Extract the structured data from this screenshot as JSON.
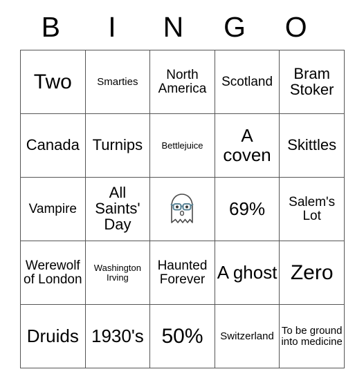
{
  "card": {
    "title": "BINGO",
    "header_letters": [
      "B",
      "I",
      "N",
      "G",
      "O"
    ],
    "rows": [
      [
        {
          "text": "Two",
          "size": "t-xxl"
        },
        {
          "text": "Smarties",
          "size": "t-sm"
        },
        {
          "text": "North America",
          "size": "t-md"
        },
        {
          "text": "Scotland",
          "size": "t-md"
        },
        {
          "text": "Bram Stoker",
          "size": "t-lg"
        }
      ],
      [
        {
          "text": "Canada",
          "size": "t-lg"
        },
        {
          "text": "Turnips",
          "size": "t-lg"
        },
        {
          "text": "Bettlejuice",
          "size": "t-xs"
        },
        {
          "text": "A coven",
          "size": "t-xl"
        },
        {
          "text": "Skittles",
          "size": "t-lg"
        }
      ],
      [
        {
          "text": "Vampire",
          "size": "t-md"
        },
        {
          "text": "All Saints' Day",
          "size": "t-lg"
        },
        {
          "text": "",
          "size": "t-md",
          "icon": "ghost-with-glasses-icon"
        },
        {
          "text": "69%",
          "size": "t-xl"
        },
        {
          "text": "Salem's Lot",
          "size": "t-md"
        }
      ],
      [
        {
          "text": "Werewolf of London",
          "size": "t-md"
        },
        {
          "text": "Washington Irving",
          "size": "t-xs"
        },
        {
          "text": "Haunted Forever",
          "size": "t-md"
        },
        {
          "text": "A ghost",
          "size": "t-xl"
        },
        {
          "text": "Zero",
          "size": "t-xxl"
        }
      ],
      [
        {
          "text": "Druids",
          "size": "t-xl"
        },
        {
          "text": "1930's",
          "size": "t-xl"
        },
        {
          "text": "50%",
          "size": "t-xxl"
        },
        {
          "text": "Switzerland",
          "size": "t-sm"
        },
        {
          "text": "To be ground into medicine",
          "size": "t-sm"
        }
      ]
    ]
  },
  "colors": {
    "border": "#555555",
    "text": "#000000",
    "background": "#ffffff",
    "ghost_outline": "#4a4a4a",
    "ghost_glasses": "#5b8496"
  }
}
